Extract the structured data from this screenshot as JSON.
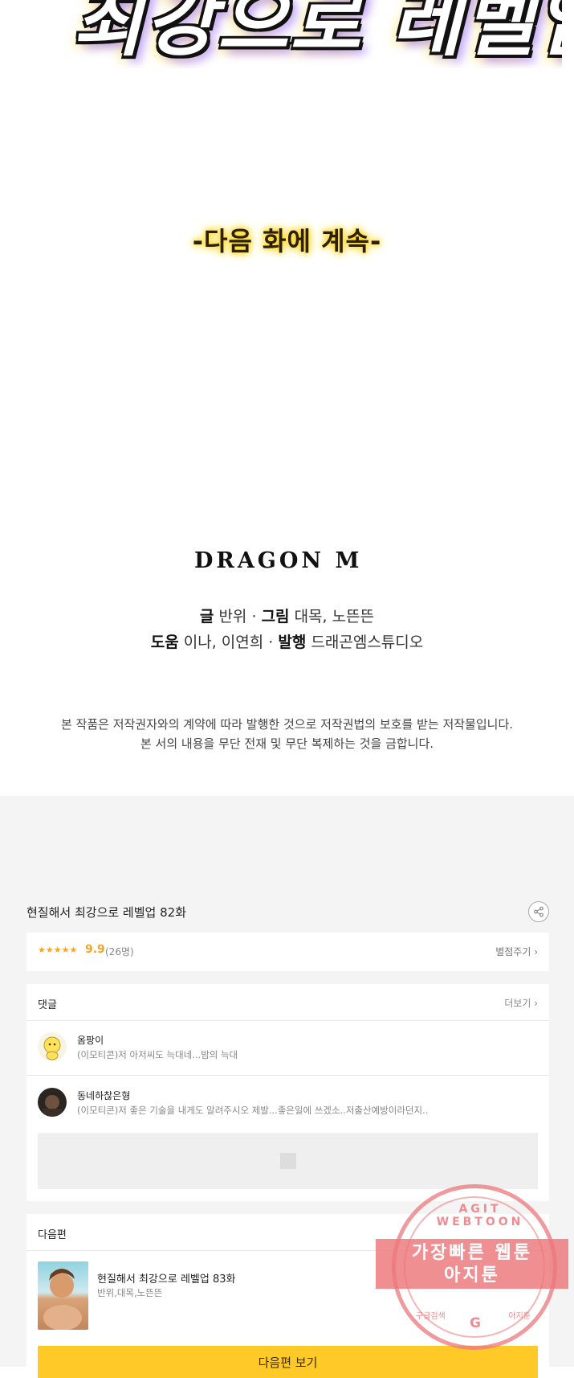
{
  "comic": {
    "title_art_text": "최강으로 레벨업!",
    "continue_text": "-다음 화에 계속-",
    "publisher_logo": "DRAGON M",
    "credits": {
      "writer_label": "글",
      "writer": "반위",
      "artist_label": "그림",
      "artist": "대목, 노뜬뜬",
      "assist_label": "도움",
      "assist": "이나, 이연희",
      "publisher_label": "발행",
      "publisher": "드래곤엠스튜디오",
      "sep": "·"
    },
    "notice_line1": "본 작품은 저작권자와의 계약에 따라 발행한 것으로 저작권법의 보호를 받는 저작물입니다.",
    "notice_line2": "본 서의 내용을 무단 전재 및 무단 복제하는 것을 금합니다."
  },
  "episode": {
    "title": "현질해서 최강으로 레벨업 82화",
    "share_icon": "share-icon"
  },
  "rating": {
    "stars": "★★★★★",
    "score": "9.9",
    "count": "(26명)",
    "rate_label": "별점주기 ›"
  },
  "comments": {
    "header": "댓글",
    "more_label": "더보기 ›",
    "items": [
      {
        "name": "옴팡이",
        "text": "(이모티콘)저 아저씨도 늑대네...밤의 늑대"
      },
      {
        "name": "동네하찮은형",
        "text": "(이모티콘)저 좋은 기술을 내게도 알려주시오 제발...좋은일에 쓰겠소..저출산예방이라던지.."
      }
    ]
  },
  "next": {
    "header": "다음편",
    "title": "현질해서 최강으로 레벨업 83화",
    "authors": "반위,대목,노뜬뜬",
    "button": "다음편 보기"
  },
  "watermark": {
    "top": "AGIT WEBTOON",
    "line1": "가장빠른 웹툰",
    "line2": "아지툰",
    "left": "구글검색",
    "right": "아지툰",
    "g": "G"
  },
  "colors": {
    "accent_yellow": "#ffc928",
    "star_orange": "#f5a623",
    "stamp_red": "#eb787d"
  }
}
